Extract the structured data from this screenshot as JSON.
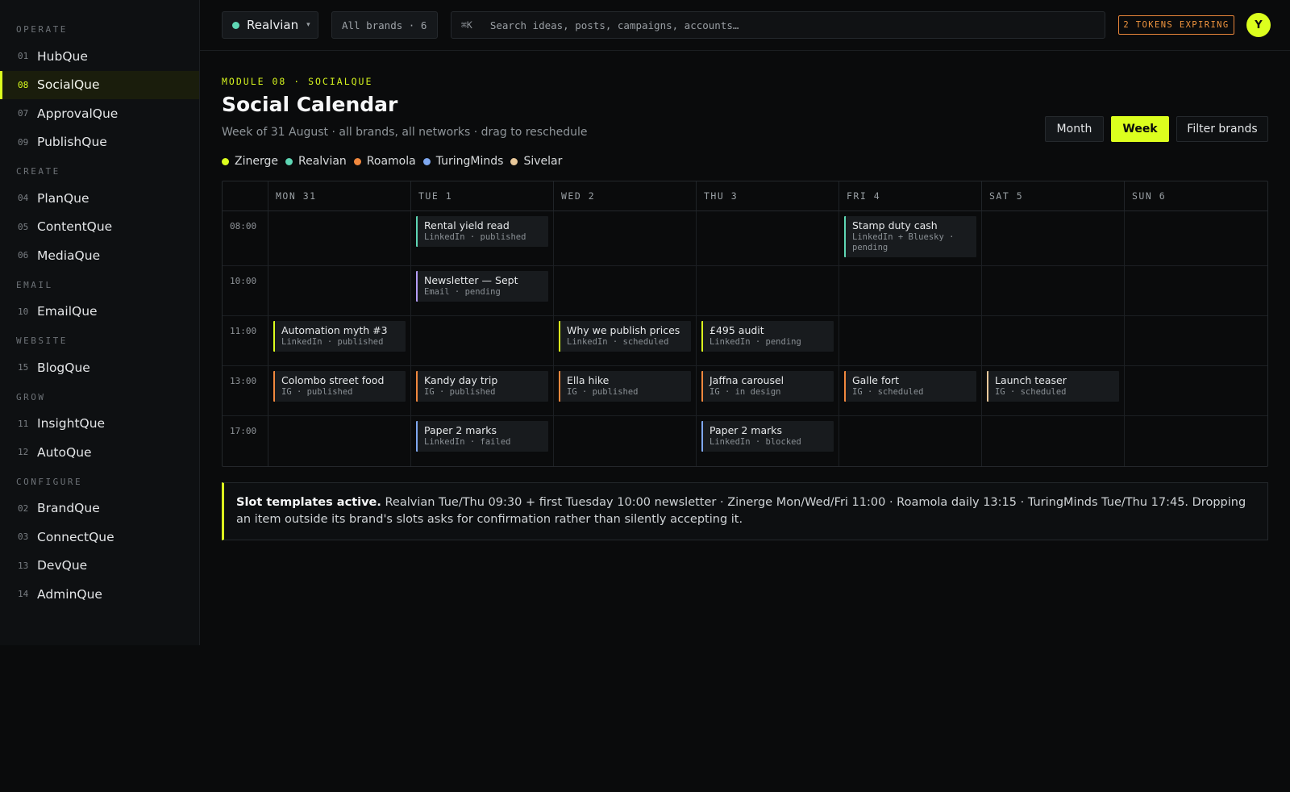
{
  "sidebar": {
    "sections": [
      {
        "title": "OPERATE",
        "items": [
          {
            "num": "01",
            "label": "HubQue",
            "active": false
          },
          {
            "num": "08",
            "label": "SocialQue",
            "active": true
          },
          {
            "num": "07",
            "label": "ApprovalQue",
            "active": false
          },
          {
            "num": "09",
            "label": "PublishQue",
            "active": false
          }
        ]
      },
      {
        "title": "CREATE",
        "items": [
          {
            "num": "04",
            "label": "PlanQue",
            "active": false
          },
          {
            "num": "05",
            "label": "ContentQue",
            "active": false
          },
          {
            "num": "06",
            "label": "MediaQue",
            "active": false
          }
        ]
      },
      {
        "title": "EMAIL",
        "items": [
          {
            "num": "10",
            "label": "EmailQue",
            "active": false
          }
        ]
      },
      {
        "title": "WEBSITE",
        "items": [
          {
            "num": "15",
            "label": "BlogQue",
            "active": false
          }
        ]
      },
      {
        "title": "GROW",
        "items": [
          {
            "num": "11",
            "label": "InsightQue",
            "active": false
          },
          {
            "num": "12",
            "label": "AutoQue",
            "active": false
          }
        ]
      },
      {
        "title": "CONFIGURE",
        "items": [
          {
            "num": "02",
            "label": "BrandQue",
            "active": false
          },
          {
            "num": "03",
            "label": "ConnectQue",
            "active": false
          },
          {
            "num": "13",
            "label": "DevQue",
            "active": false
          },
          {
            "num": "14",
            "label": "AdminQue",
            "active": false
          }
        ]
      }
    ]
  },
  "topbar": {
    "brand_name": "Realvian",
    "brand_color": "#5ed6b4",
    "brand_caret": "▾",
    "all_brands": "All brands · 6",
    "search_kbd": "⌘K",
    "search_placeholder": "Search ideas, posts, campaigns, accounts…",
    "tokens_badge": "2 TOKENS EXPIRING",
    "avatar_initial": "Y"
  },
  "header": {
    "module_tag": "MODULE 08 · SOCIALQUE",
    "title": "Social Calendar",
    "subtitle": "Week of 31 August · all brands, all networks · drag to reschedule",
    "buttons": {
      "month": "Month",
      "week": "Week",
      "filter": "Filter brands"
    }
  },
  "legend": [
    {
      "name": "Zinerge",
      "color": "#dcff1e"
    },
    {
      "name": "Realvian",
      "color": "#5ed6b4"
    },
    {
      "name": "Roamola",
      "color": "#f0883e"
    },
    {
      "name": "TuringMinds",
      "color": "#7fa8f0"
    },
    {
      "name": "Sivelar",
      "color": "#e8c89a"
    }
  ],
  "calendar": {
    "days": [
      "MON 31",
      "TUE 1",
      "WED 2",
      "THU 3",
      "FRI 4",
      "SAT 5",
      "SUN 6"
    ],
    "times": [
      "08:00",
      "10:00",
      "11:00",
      "13:00",
      "17:00"
    ],
    "events": [
      {
        "row": 0,
        "day": 1,
        "title": "Rental yield read",
        "meta": "LinkedIn · published",
        "color": "#5ed6b4"
      },
      {
        "row": 0,
        "day": 4,
        "title": "Stamp duty cash",
        "meta": "LinkedIn + Bluesky · pending",
        "color": "#5ed6b4"
      },
      {
        "row": 1,
        "day": 1,
        "title": "Newsletter — Sept",
        "meta": "Email · pending",
        "color": "#b49cf5"
      },
      {
        "row": 2,
        "day": 0,
        "title": "Automation myth #3",
        "meta": "LinkedIn · published",
        "color": "#dcff1e"
      },
      {
        "row": 2,
        "day": 2,
        "title": "Why we publish prices",
        "meta": "LinkedIn · scheduled",
        "color": "#dcff1e"
      },
      {
        "row": 2,
        "day": 3,
        "title": "£495 audit",
        "meta": "LinkedIn · pending",
        "color": "#dcff1e"
      },
      {
        "row": 3,
        "day": 0,
        "title": "Colombo street food",
        "meta": "IG · published",
        "color": "#f0883e"
      },
      {
        "row": 3,
        "day": 1,
        "title": "Kandy day trip",
        "meta": "IG · published",
        "color": "#f0883e"
      },
      {
        "row": 3,
        "day": 2,
        "title": "Ella hike",
        "meta": "IG · published",
        "color": "#f0883e"
      },
      {
        "row": 3,
        "day": 3,
        "title": "Jaffna carousel",
        "meta": "IG · in design",
        "color": "#f0883e"
      },
      {
        "row": 3,
        "day": 4,
        "title": "Galle fort",
        "meta": "IG · scheduled",
        "color": "#f0883e"
      },
      {
        "row": 3,
        "day": 5,
        "title": "Launch teaser",
        "meta": "IG · scheduled",
        "color": "#e8c89a"
      },
      {
        "row": 4,
        "day": 1,
        "title": "Paper 2 marks",
        "meta": "LinkedIn · failed",
        "color": "#7fa8f0"
      },
      {
        "row": 4,
        "day": 3,
        "title": "Paper 2 marks",
        "meta": "LinkedIn · blocked",
        "color": "#7fa8f0"
      }
    ]
  },
  "banner": {
    "lead": "Slot templates active.",
    "text": " Realvian Tue/Thu 09:30 + first Tuesday 10:00 newsletter · Zinerge Mon/Wed/Fri 11:00 · Roamola daily 13:15 · TuringMinds Tue/Thu 17:45. Dropping an item outside its brand's slots asks for confirmation rather than silently accepting it."
  }
}
